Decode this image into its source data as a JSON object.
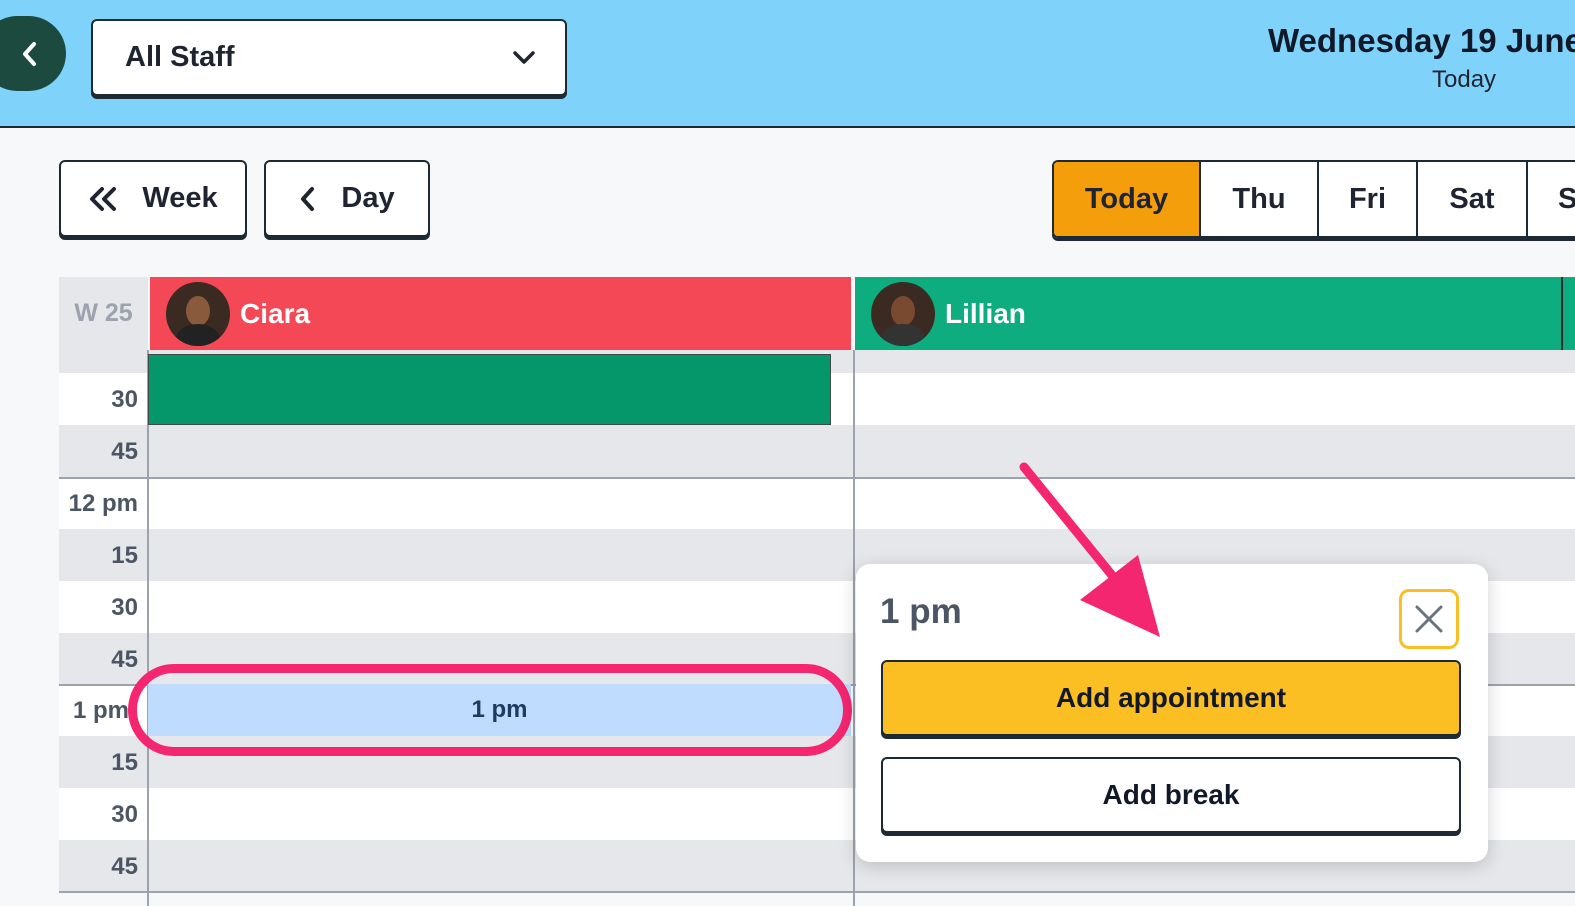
{
  "header": {
    "staff_select": "All Staff",
    "date_title": "Wednesday 19 June",
    "date_sub": "Today"
  },
  "nav": {
    "week_label": "Week",
    "day_label": "Day",
    "tabs": [
      "Today",
      "Thu",
      "Fri",
      "Sat",
      "S"
    ]
  },
  "calendar": {
    "week_number": "W 25",
    "staff": [
      {
        "name": "Ciara",
        "color": "#f44857"
      },
      {
        "name": "Lillian",
        "color": "#0ead7f"
      }
    ],
    "time_labels": [
      "30",
      "45",
      "12 pm",
      "15",
      "30",
      "45",
      "1 pm",
      "15",
      "30",
      "45"
    ],
    "selected_slot": "1 pm"
  },
  "popover": {
    "title": "1 pm",
    "add_appointment": "Add appointment",
    "add_break": "Add break"
  },
  "colors": {
    "topbar": "#7fd3fb",
    "accent": "#f59e0b",
    "highlight": "#f3266f"
  }
}
